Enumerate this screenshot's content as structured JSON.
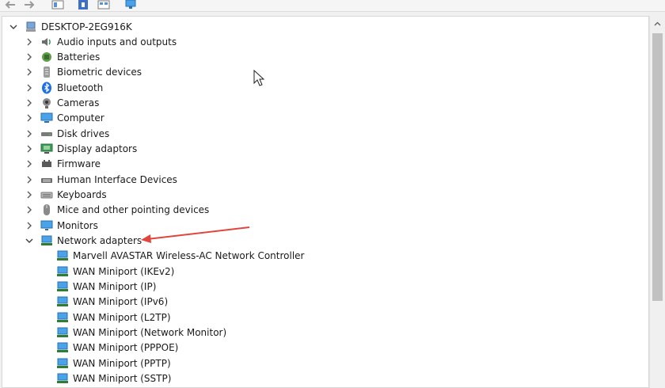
{
  "toolbar": {
    "buttons": [
      "back-icon",
      "forward-icon",
      "properties-icon",
      "help-icon",
      "show-hidden-icon",
      "monitor-icon"
    ]
  },
  "tree": {
    "root": "DESKTOP-2EG916K",
    "categories": [
      {
        "label": "Audio inputs and outputs",
        "icon": "speaker-icon"
      },
      {
        "label": "Batteries",
        "icon": "battery-icon"
      },
      {
        "label": "Biometric devices",
        "icon": "fingerprint-icon"
      },
      {
        "label": "Bluetooth",
        "icon": "bluetooth-icon"
      },
      {
        "label": "Cameras",
        "icon": "camera-icon"
      },
      {
        "label": "Computer",
        "icon": "computer-icon"
      },
      {
        "label": "Disk drives",
        "icon": "disk-icon"
      },
      {
        "label": "Display adaptors",
        "icon": "display-adapter-icon"
      },
      {
        "label": "Firmware",
        "icon": "firmware-icon"
      },
      {
        "label": "Human Interface Devices",
        "icon": "hid-icon"
      },
      {
        "label": "Keyboards",
        "icon": "keyboard-icon"
      },
      {
        "label": "Mice and other pointing devices",
        "icon": "mouse-icon"
      },
      {
        "label": "Monitors",
        "icon": "monitor-icon"
      },
      {
        "label": "Network adapters",
        "icon": "network-adapter-icon",
        "expanded": true
      }
    ],
    "network_children": [
      "Marvell AVASTAR Wireless-AC Network Controller",
      "WAN Miniport (IKEv2)",
      "WAN Miniport (IP)",
      "WAN Miniport (IPv6)",
      "WAN Miniport (L2TP)",
      "WAN Miniport (Network Monitor)",
      "WAN Miniport (PPPOE)",
      "WAN Miniport (PPTP)",
      "WAN Miniport (SSTP)"
    ]
  },
  "colors": {
    "accent_blue": "#1e88e5",
    "annotation_red": "#e0463c",
    "tree_bg": "#ffffff"
  }
}
